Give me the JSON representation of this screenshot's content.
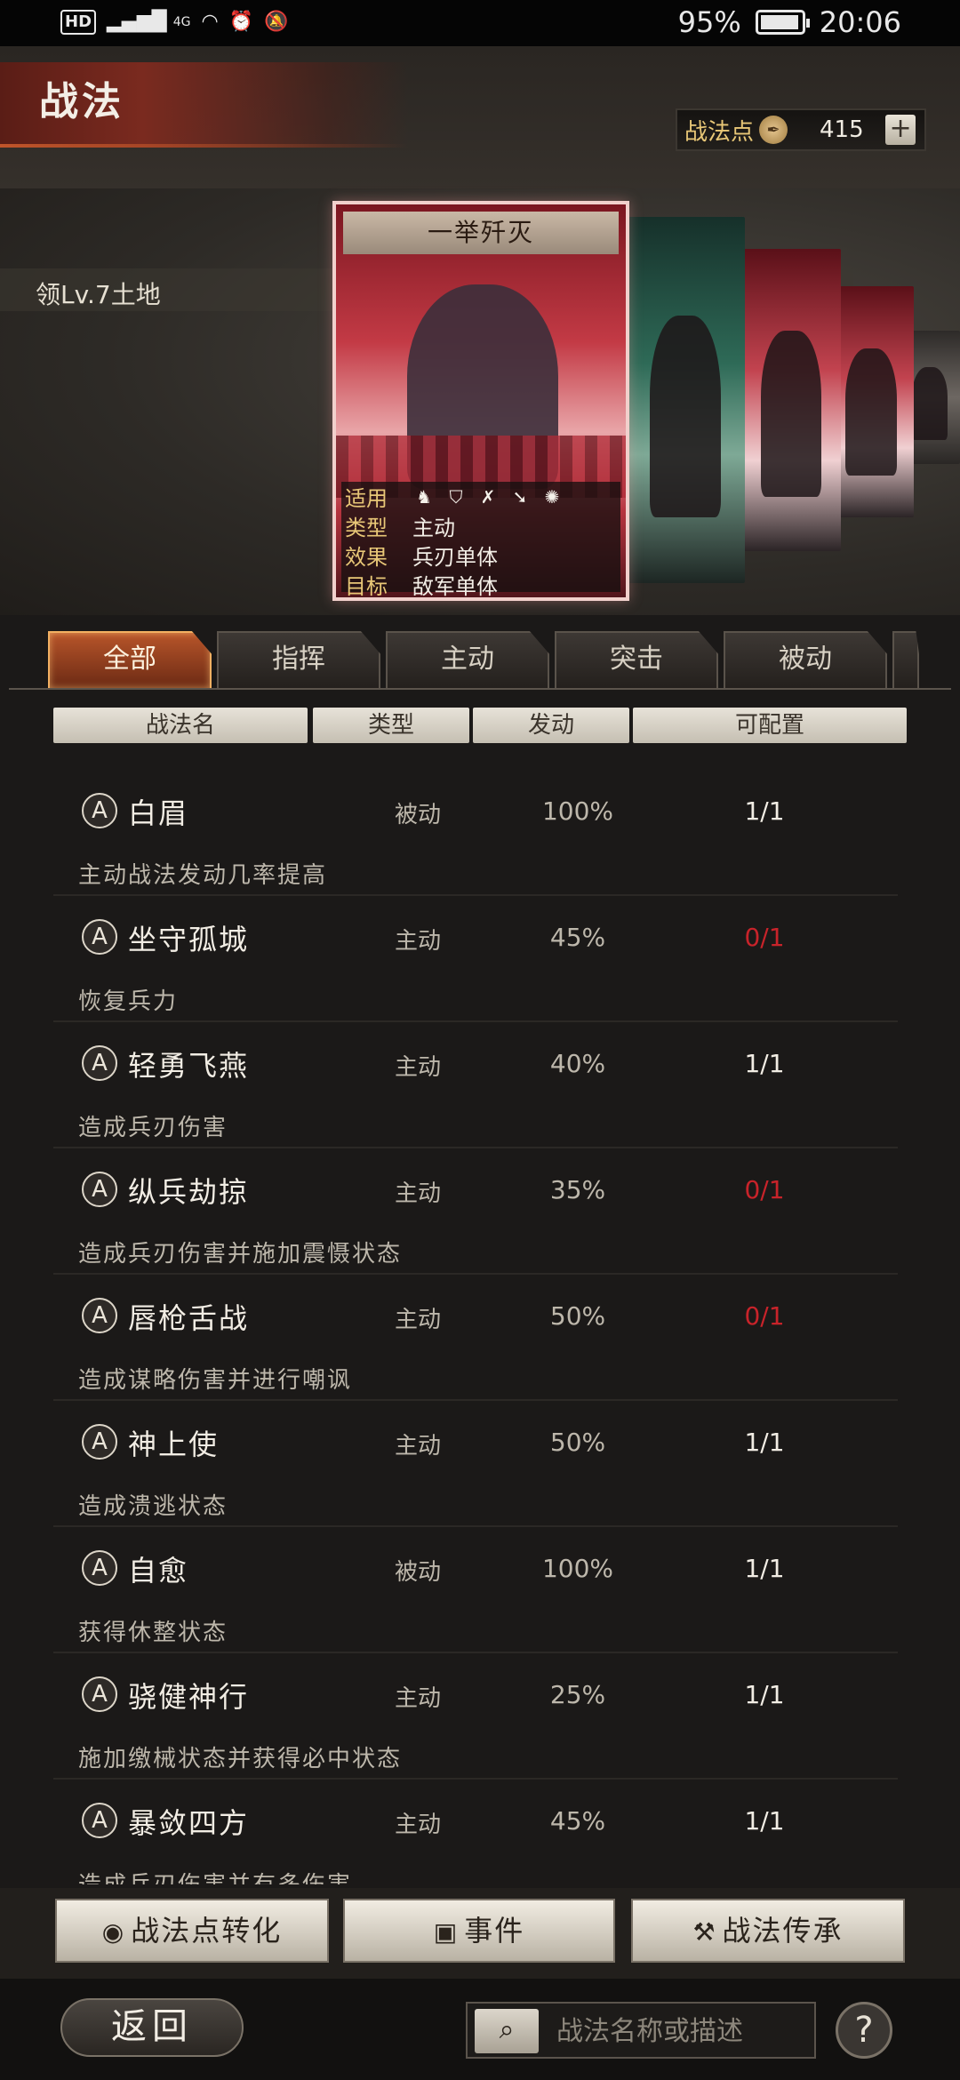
{
  "status_bar": {
    "network": "4G",
    "hd_label": "HD",
    "battery": "95%",
    "battery_level": 0.95,
    "time": "20:06"
  },
  "header": {
    "title": "战法",
    "points_label": "战法点",
    "points_value": "415",
    "add_label": "+"
  },
  "land_text": "领Lv.7土地",
  "featured_card": {
    "name": "一举歼灭",
    "rows": [
      {
        "key": "适用",
        "value": ""
      },
      {
        "key": "类型",
        "value": "主动"
      },
      {
        "key": "效果",
        "value": "兵刃单体"
      },
      {
        "key": "目标",
        "value": "敌军单体"
      }
    ],
    "weapons": [
      "cavalry-icon",
      "shield-icon",
      "bow-icon",
      "spear-icon",
      "wheel-icon"
    ]
  },
  "tabs": [
    {
      "label": "全部",
      "active": true
    },
    {
      "label": "指挥",
      "active": false
    },
    {
      "label": "主动",
      "active": false
    },
    {
      "label": "突击",
      "active": false
    },
    {
      "label": "被动",
      "active": false
    }
  ],
  "columns": [
    "战法名",
    "类型",
    "发动",
    "可配置"
  ],
  "tactics": [
    {
      "grade": "A",
      "name": "白眉",
      "type": "被动",
      "rate": "100%",
      "config": "1/1",
      "config_full": true,
      "desc": "主动战法发动几率提高"
    },
    {
      "grade": "A",
      "name": "坐守孤城",
      "type": "主动",
      "rate": "45%",
      "config": "0/1",
      "config_full": false,
      "desc": "恢复兵力"
    },
    {
      "grade": "A",
      "name": "轻勇飞燕",
      "type": "主动",
      "rate": "40%",
      "config": "1/1",
      "config_full": true,
      "desc": "造成兵刃伤害"
    },
    {
      "grade": "A",
      "name": "纵兵劫掠",
      "type": "主动",
      "rate": "35%",
      "config": "0/1",
      "config_full": false,
      "desc": "造成兵刃伤害并施加震慑状态"
    },
    {
      "grade": "A",
      "name": "唇枪舌战",
      "type": "主动",
      "rate": "50%",
      "config": "0/1",
      "config_full": false,
      "desc": "造成谋略伤害并进行嘲讽"
    },
    {
      "grade": "A",
      "name": "神上使",
      "type": "主动",
      "rate": "50%",
      "config": "1/1",
      "config_full": true,
      "desc": "造成溃逃状态"
    },
    {
      "grade": "A",
      "name": "自愈",
      "type": "被动",
      "rate": "100%",
      "config": "1/1",
      "config_full": true,
      "desc": "获得休整状态"
    },
    {
      "grade": "A",
      "name": "骁健神行",
      "type": "主动",
      "rate": "25%",
      "config": "1/1",
      "config_full": true,
      "desc": "施加缴械状态并获得必中状态"
    },
    {
      "grade": "A",
      "name": "暴敛四方",
      "type": "主动",
      "rate": "45%",
      "config": "1/1",
      "config_full": true,
      "desc": "造成兵刃伤害并有多伤害"
    }
  ],
  "bottom_buttons": {
    "convert": "战法点转化",
    "event": "事件",
    "inherit": "战法传承"
  },
  "footer": {
    "back": "返回",
    "search_placeholder": "战法名称或描述",
    "help": "?"
  },
  "colors": {
    "accent": "#b8552a",
    "unavailable": "#c8232a",
    "gold": "#e8c777"
  }
}
